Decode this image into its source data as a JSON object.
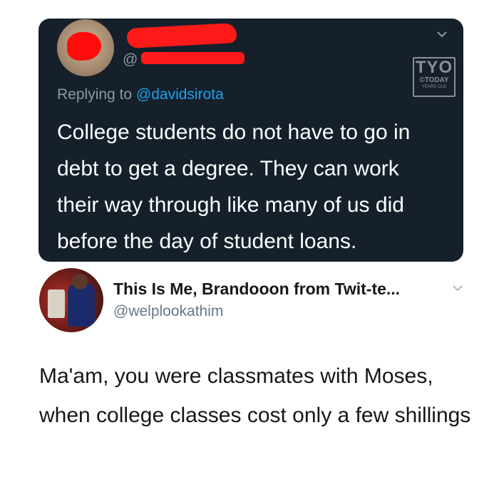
{
  "original_tweet": {
    "handle_prefix": "@",
    "replying_prefix": "Replying to",
    "replying_mention": "@davidsirota",
    "text": "College students do not have to go in\ndebt to get a degree. They can work\ntheir way through like many of us did\nbefore the day of student loans.",
    "name_redacted": true,
    "colors": {
      "background": "#15202b",
      "redaction": "#ff1a1a",
      "mention": "#1da1f2"
    }
  },
  "watermark": {
    "brand": "TYO",
    "line2": "©TODAY",
    "line3": "YEARS OLD"
  },
  "reply_tweet": {
    "display_name": "This Is Me, Brandooon from Twit-te...",
    "handle": "@welplookathim",
    "text_main": "Ma'am, you were classmates with Moses, when college classes cost only a few ",
    "text_end": "shillings"
  },
  "icons": [
    "chevron-down-icon",
    "avatar",
    "tyo-watermark"
  ]
}
